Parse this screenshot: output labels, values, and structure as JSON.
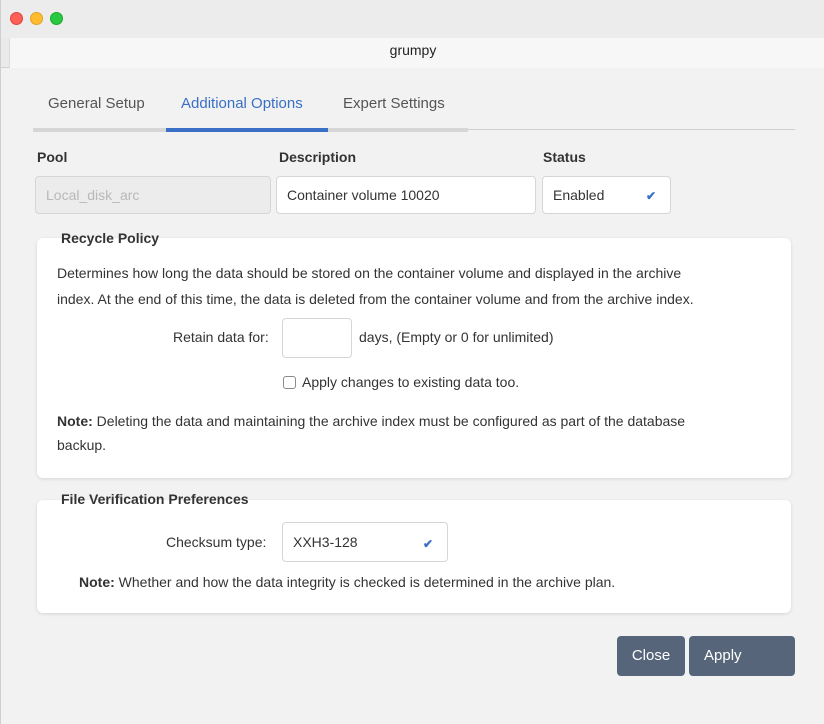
{
  "window": {
    "title": "grumpy"
  },
  "tabs": [
    {
      "label": "General Setup",
      "active": false
    },
    {
      "label": "Additional Options",
      "active": true
    },
    {
      "label": "Expert Settings",
      "active": false
    }
  ],
  "pool": {
    "label": "Pool",
    "value": "Local_disk_arc"
  },
  "description": {
    "label": "Description",
    "value": "Container volume 10020"
  },
  "status": {
    "label": "Status",
    "value": "Enabled"
  },
  "recycle": {
    "title": "Recycle Policy",
    "desc_line1": "Determines how long the data should be stored on the container volume and displayed in the archive",
    "desc_line2": "index. At the end of this time, the data is deleted from the container volume and from the archive index.",
    "retain_label": "Retain data for:",
    "retain_value": "",
    "days_hint": "days, (Empty or 0 for unlimited)",
    "apply_existing_label": "Apply changes to existing data too.",
    "apply_existing_checked": false,
    "note_bold": "Note:",
    "note_line1": "Deleting the data and maintaining the archive index must be configured as part of the database",
    "note_line2": "backup."
  },
  "verification": {
    "title": "File Verification Preferences",
    "checksum_label": "Checksum type:",
    "checksum_value": "XXH3-128",
    "note_bold": "Note:",
    "note_text": "Whether and how the data integrity is checked is determined in the archive plan."
  },
  "buttons": {
    "close": "Close",
    "apply": "Apply"
  },
  "colors": {
    "accent": "#3a6fc6",
    "button": "#56657a"
  }
}
